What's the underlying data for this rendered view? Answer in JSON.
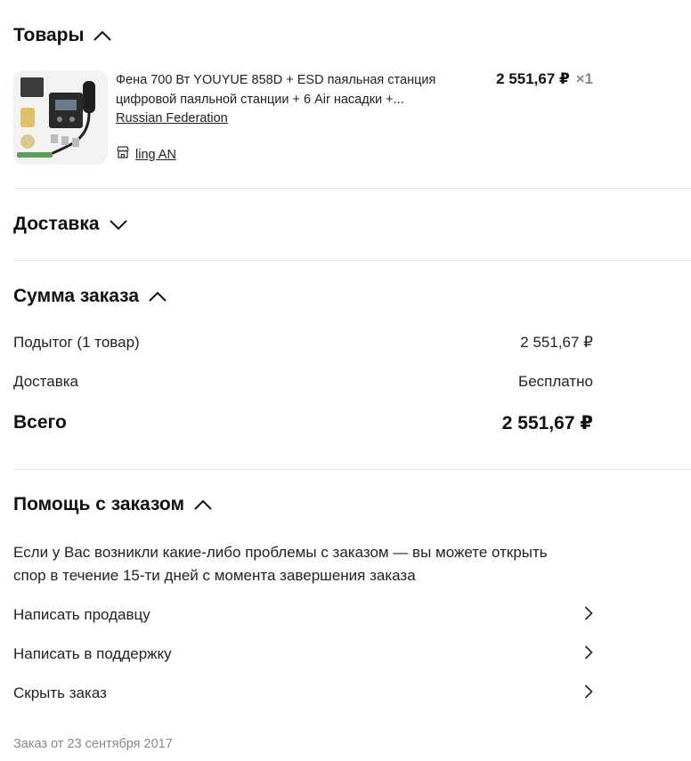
{
  "products_section": {
    "title": "Товары",
    "item": {
      "title_line1": "Фена 700 Вт YOUYUE 858D + ESD паяльная станция",
      "title_line2": "цифровой паяльной станции + 6 Air насадки +...",
      "country": "Russian Federation",
      "seller": "ling AN",
      "price": "2 551,67 ₽",
      "quantity": "×1"
    }
  },
  "delivery_section": {
    "title": "Доставка"
  },
  "summary_section": {
    "title": "Сумма заказа",
    "subtotal_label": "Подытог (1 товар)",
    "subtotal_value": "2 551,67 ₽",
    "delivery_label": "Доставка",
    "delivery_value": "Бесплатно",
    "total_label": "Всего",
    "total_value": "2 551,67 ₽"
  },
  "help_section": {
    "title": "Помощь с заказом",
    "text_line1": "Если у Вас возникли какие-либо проблемы с заказом — вы можете открыть",
    "text_line2": "спор в течение 15-ти дней с момента завершения заказа",
    "actions": [
      "Написать продавцу",
      "Написать в поддержку",
      "Скрыть заказ"
    ]
  },
  "footer": {
    "order_date": "Заказ от 23 сентября 2017"
  },
  "icons": {
    "products_toggle": "chevron-up-icon",
    "delivery_toggle": "chevron-down-icon",
    "summary_toggle": "chevron-up-icon",
    "help_toggle": "chevron-up-icon",
    "seller": "store-icon",
    "action": "chevron-right-icon"
  }
}
